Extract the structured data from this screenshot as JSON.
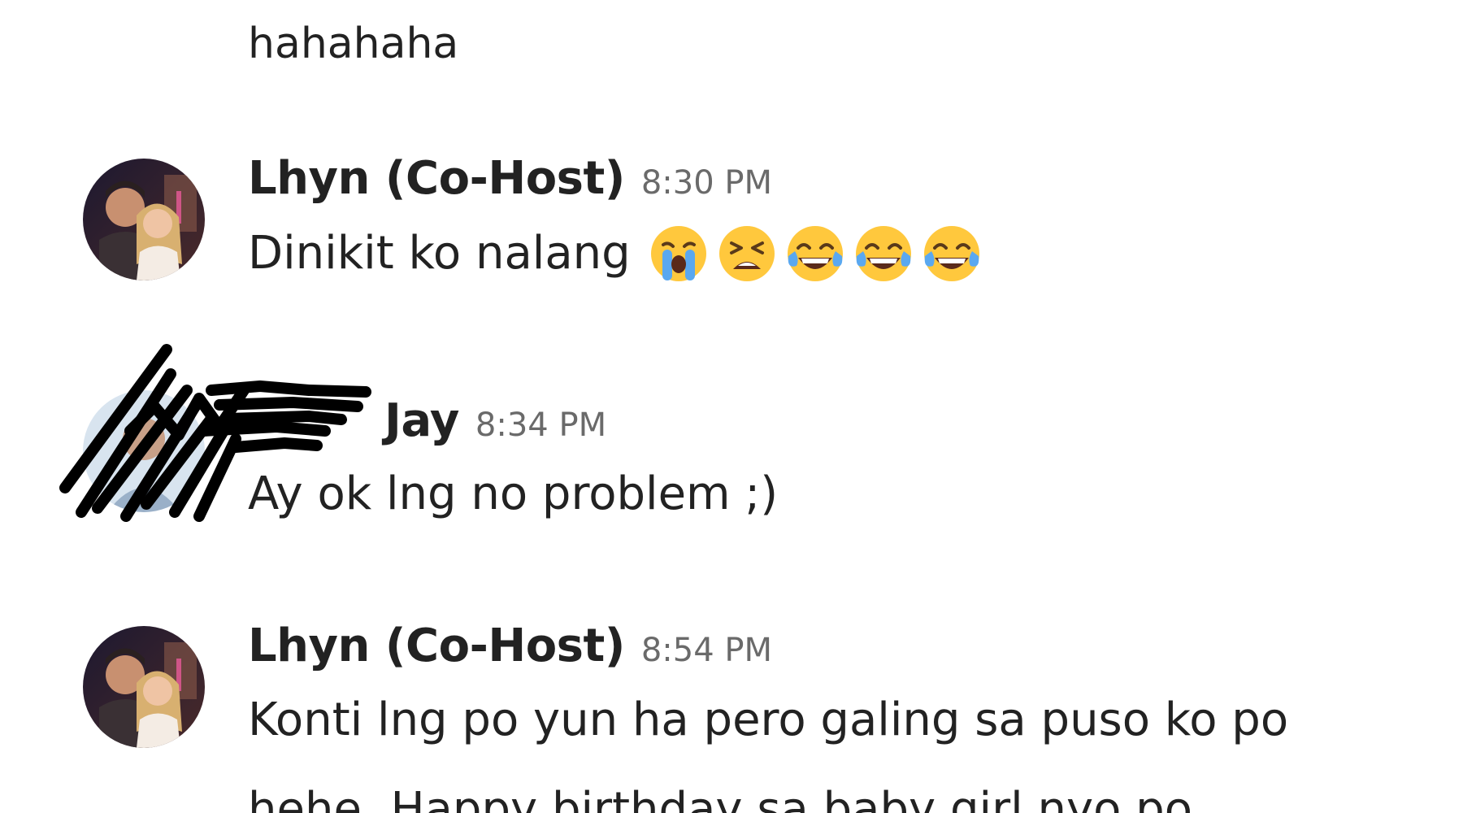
{
  "thread": {
    "continuation_text": "hahahaha",
    "messages": [
      {
        "sender": "Lhyn (Co-Host)",
        "time": "8:30 PM",
        "text": "Dinikit ko nalang",
        "emojis": [
          "loudly-crying-face",
          "tired-face",
          "face-with-tears-of-joy",
          "face-with-tears-of-joy",
          "face-with-tears-of-joy"
        ]
      },
      {
        "sender": "Jay",
        "time": "8:34 PM",
        "text": "Ay ok lng no problem ;)"
      },
      {
        "sender": "Lhyn (Co-Host)",
        "time": "8:54 PM",
        "text": "Konti lng po yun ha pero galing sa puso ko po"
      }
    ],
    "cut_off_line": "hehe. Happy birthday sa baby girl nyo po"
  },
  "colors": {
    "text": "#222222",
    "timestamp": "#6a6a6a",
    "background": "#ffffff",
    "emoji_yellow": "#FFC83D"
  }
}
